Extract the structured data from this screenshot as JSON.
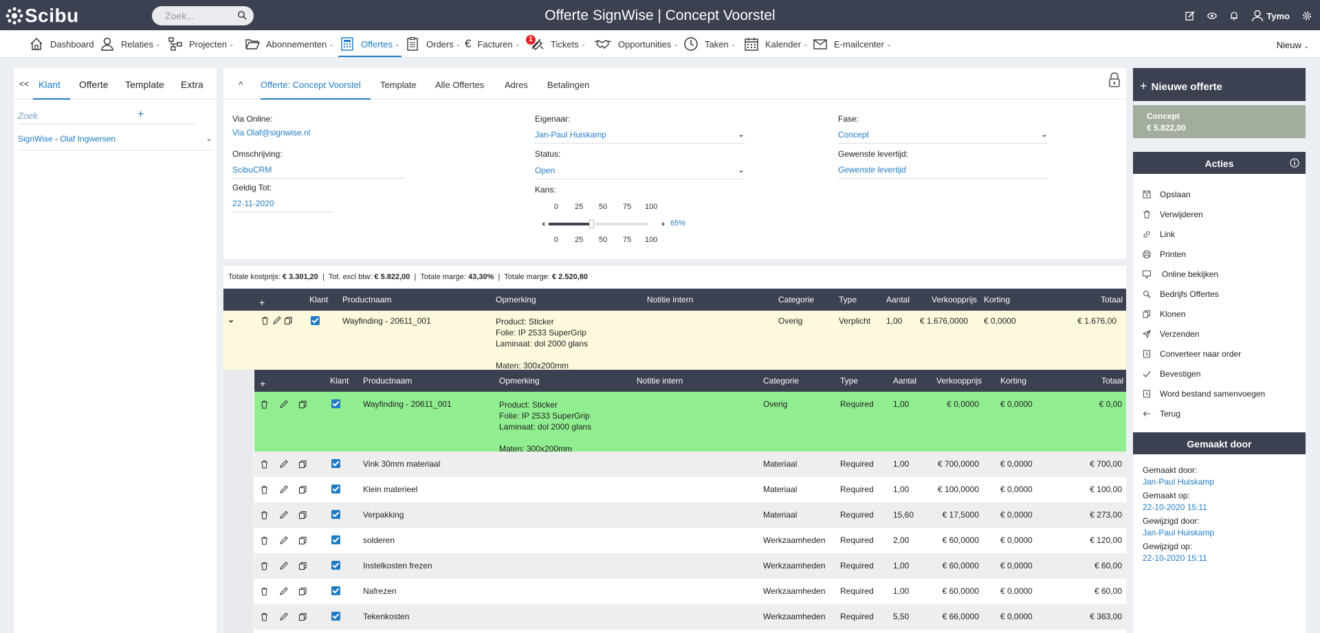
{
  "app": {
    "logo": "Scibu",
    "search_placeholder": "Zoek...",
    "title": "Offerte SignWise | Concept Voorstel",
    "user": "Tymo"
  },
  "nav": {
    "items": [
      {
        "label": "Dashboard",
        "icon": "home-icon"
      },
      {
        "label": "Relaties",
        "icon": "user-icon"
      },
      {
        "label": "Projecten",
        "icon": "project-icon"
      },
      {
        "label": "Abonnementen",
        "icon": "folder-icon"
      },
      {
        "label": "Offertes",
        "icon": "calculator-icon"
      },
      {
        "label": "Orders",
        "icon": "clipboard-icon"
      },
      {
        "label": "Facturen",
        "icon": "euro-icon"
      },
      {
        "label": "Tickets",
        "icon": "tools-icon",
        "badge": "1"
      },
      {
        "label": "Opportunities",
        "icon": "handshake-icon"
      },
      {
        "label": "Taken",
        "icon": "clock-icon"
      },
      {
        "label": "Kalender",
        "icon": "calendar-icon"
      },
      {
        "label": "E-mailcenter",
        "icon": "mail-icon"
      }
    ],
    "nieuw": "Nieuw"
  },
  "left": {
    "back": "<<",
    "tabs": [
      "Klant",
      "Offerte",
      "Template",
      "Extra"
    ],
    "zoek": "Zoek",
    "plus": "+",
    "customer_company": "SignWise",
    "customer_sep": " - ",
    "customer_person": "Olaf Ingwersen"
  },
  "center": {
    "collapse": "^",
    "tabs": [
      "Offerte: Concept Voorstel",
      "Template",
      "Alle Offertes",
      "Adres",
      "Betalingen"
    ],
    "fields": {
      "via_label": "Via Online:",
      "via_value": "Via Olaf@signwise.nl",
      "omschr_label": "Omschrijving:",
      "omschr_value": "ScibuCRM",
      "geldig_label": "Geldig Tot:",
      "geldig_value": "22-11-2020",
      "eigenaar_label": "Eigenaar:",
      "eigenaar_value": "Jan-Paul Huiskamp",
      "status_label": "Status:",
      "status_value": "Open",
      "kans_label": "Kans:",
      "kans_value": 65,
      "kans_text": "65%",
      "kans_ticks": [
        "0",
        "25",
        "50",
        "75",
        "100"
      ],
      "fase_label": "Fase:",
      "fase_value": "Concept",
      "lever_label": "Gewenste levertijd:",
      "lever_placeholder": "Gewenste levertijd"
    },
    "totals": {
      "kostprijs_label": "Totale kostprijs:",
      "kostprijs": "€ 3.301,20",
      "excl_label": "Tot. excl btw:",
      "excl": "€ 5.822,00",
      "marge_pct_label": "Totale marge:",
      "marge_pct": "43,30%",
      "marge_label": "Totale marge:",
      "marge": "€ 2.520,80",
      "sep": "|"
    },
    "grid": {
      "plus": "+",
      "headers": [
        "Klant",
        "Productnaam",
        "Opmerking",
        "Notitie intern",
        "Categorie",
        "Type",
        "Aantal",
        "Verkoopprijs",
        "Korting",
        "Totaal"
      ],
      "main_row": {
        "product": "Wayfinding - 20611_001",
        "opmerking": [
          "Product: Sticker",
          "Folie: IP 2533 SuperGrip",
          "Laminaat: dol 2000 glans",
          "",
          "Maten: 300x200mm"
        ],
        "categorie": "Overig",
        "type": "Verplicht",
        "aantal": "1,00",
        "prijs": "€ 1.676,0000",
        "korting": "€ 0,0000",
        "totaal": "€ 1.676,00"
      },
      "sub_rows": [
        {
          "product": "Wayfinding - 20611_001",
          "opmerking": [
            "Product: Sticker",
            "Folie: IP 2533 SuperGrip",
            "Laminaat: dol 2000 glans",
            "",
            "Maten: 300x200mm"
          ],
          "categorie": "Overig",
          "type": "Required",
          "aantal": "1,00",
          "prijs": "€ 0,0000",
          "korting": "€ 0,0000",
          "totaal": "€ 0,00"
        },
        {
          "product": "Vink 30mm materiaal",
          "opmerking": [],
          "categorie": "Materiaal",
          "type": "Required",
          "aantal": "1,00",
          "prijs": "€ 700,0000",
          "korting": "€ 0,0000",
          "totaal": "€ 700,00"
        },
        {
          "product": "Klein materieel",
          "opmerking": [],
          "categorie": "Materiaal",
          "type": "Required",
          "aantal": "1,00",
          "prijs": "€ 100,0000",
          "korting": "€ 0,0000",
          "totaal": "€ 100,00"
        },
        {
          "product": "Verpakking",
          "opmerking": [],
          "categorie": "Materiaal",
          "type": "Required",
          "aantal": "15,60",
          "prijs": "€ 17,5000",
          "korting": "€ 0,0000",
          "totaal": "€ 273,00"
        },
        {
          "product": "solderen",
          "opmerking": [],
          "categorie": "Werkzaamheden",
          "type": "Required",
          "aantal": "2,00",
          "prijs": "€ 60,0000",
          "korting": "€ 0,0000",
          "totaal": "€ 120,00"
        },
        {
          "product": "Instelkosten frezen",
          "opmerking": [],
          "categorie": "Werkzaamheden",
          "type": "Required",
          "aantal": "1,00",
          "prijs": "€ 60,0000",
          "korting": "€ 0,0000",
          "totaal": "€ 60,00"
        },
        {
          "product": "Nafrezen",
          "opmerking": [],
          "categorie": "Werkzaamheden",
          "type": "Required",
          "aantal": "1,00",
          "prijs": "€ 60,0000",
          "korting": "€ 0,0000",
          "totaal": "€ 60,00"
        },
        {
          "product": "Tekenkosten",
          "opmerking": [],
          "categorie": "Werkzaamheden",
          "type": "Required",
          "aantal": "5,50",
          "prijs": "€ 66,0000",
          "korting": "€ 0,0000",
          "totaal": "€ 363,00"
        }
      ]
    }
  },
  "right": {
    "new": "Nieuwe offerte",
    "concept_label": "Concept",
    "concept_value": "€ 5.822,00",
    "acties_title": "Acties",
    "actions": [
      {
        "label": "Opslaan",
        "icon": "save-icon"
      },
      {
        "label": "Verwijderen",
        "icon": "trash-icon"
      },
      {
        "label": "Link",
        "icon": "link-icon"
      },
      {
        "label": "Printen",
        "icon": "print-icon"
      },
      {
        "label": "Online bekijken",
        "icon": "monitor-icon"
      },
      {
        "label": "Bedrijfs Offertes",
        "icon": "search-icon"
      },
      {
        "label": "Klonen",
        "icon": "copy-icon"
      },
      {
        "label": "Verzenden",
        "icon": "send-icon"
      },
      {
        "label": "Converteer naar order",
        "icon": "convert-icon"
      },
      {
        "label": "Bevestigen",
        "icon": "check-icon"
      },
      {
        "label": "Word bestand samenvoegen",
        "icon": "word-icon"
      },
      {
        "label": "Terug",
        "icon": "arrow-left-icon"
      }
    ],
    "gemaakt_title": "Gemaakt door",
    "gemaakt_door_label": "Gemaakt door:",
    "gemaakt_door": "Jan-Paul Huiskamp",
    "gemaakt_op_label": "Gemaakt op:",
    "gemaakt_op": "22-10-2020 15:11",
    "gewijzigd_door_label": "Gewijzigd door:",
    "gewijzigd_door": "Jan-Paul Huiskamp",
    "gewijzigd_op_label": "Gewijzigd op:",
    "gewijzigd_op": "22-10-2020 15:11"
  }
}
